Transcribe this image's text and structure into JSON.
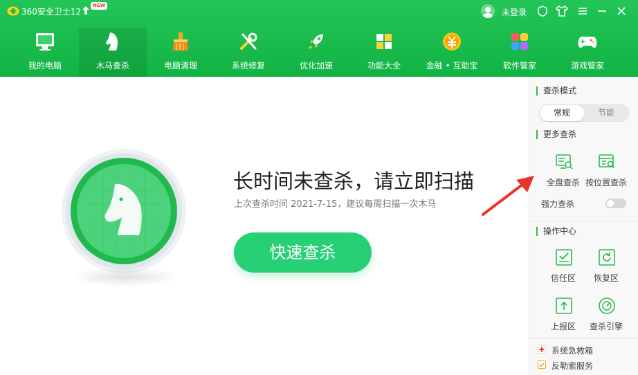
{
  "app": {
    "title": "360安全卫士12",
    "new_badge": "NEW",
    "login_label": "未登录"
  },
  "nav": {
    "items": [
      {
        "label": "我的电脑",
        "icon": "monitor-icon"
      },
      {
        "label": "木马查杀",
        "icon": "horse-icon",
        "active": true
      },
      {
        "label": "电脑清理",
        "icon": "broom-icon"
      },
      {
        "label": "系统修复",
        "icon": "wrench-icon"
      },
      {
        "label": "优化加速",
        "icon": "rocket-icon"
      },
      {
        "label": "功能大全",
        "icon": "grid-icon"
      },
      {
        "label": "金融 • 互助宝",
        "icon": "coin-icon"
      },
      {
        "label": "软件管家",
        "icon": "software-icon"
      },
      {
        "label": "游戏管家",
        "icon": "gamepad-icon"
      }
    ]
  },
  "main": {
    "headline": "长时间未查杀，请立即扫描",
    "subline": "上次查杀时间 2021-7-15，建议每周扫描一次木马",
    "scan_button": "快速查杀"
  },
  "side": {
    "mode_title": "查杀模式",
    "mode_options": [
      "常规",
      "节能"
    ],
    "mode_selected": "常规",
    "more_title": "更多查杀",
    "more_tools": [
      {
        "label": "全盘查杀",
        "icon": "full-scan-icon"
      },
      {
        "label": "按位置查杀",
        "icon": "location-scan-icon"
      }
    ],
    "force_label": "强力查杀",
    "force_enabled": false,
    "ops_title": "操作中心",
    "ops_tools": [
      {
        "label": "信任区",
        "icon": "trust-zone-icon"
      },
      {
        "label": "恢复区",
        "icon": "restore-zone-icon"
      },
      {
        "label": "上报区",
        "icon": "report-zone-icon"
      },
      {
        "label": "查杀引擎",
        "icon": "engine-icon"
      }
    ],
    "bottom_items": [
      {
        "label": "系统急救箱",
        "icon": "first-aid-icon"
      },
      {
        "label": "反勒索服务",
        "icon": "anti-ransom-icon"
      }
    ]
  },
  "colors": {
    "brand_green": "#1dbf4f",
    "scan_button": "#27cf75",
    "arrow": "#e8342c"
  }
}
